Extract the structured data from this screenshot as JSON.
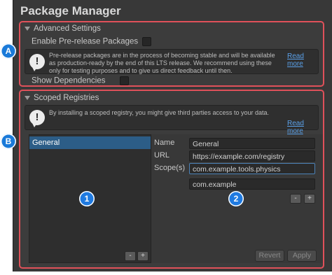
{
  "window": {
    "title": "Package Manager"
  },
  "advanced": {
    "header": "Advanced Settings",
    "prerelease_label": "Enable Pre-release Packages",
    "prerelease_checked": false,
    "help_text": "Pre-release packages are in the process of becoming stable and will be available as production-ready by the end of this LTS release. We recommend using these only for testing purposes and to give us direct feedback until then.",
    "read_more": "Read more",
    "show_deps_label": "Show Dependencies",
    "show_deps_checked": false
  },
  "scoped": {
    "header": "Scoped Registries",
    "help_text": "By installing a scoped registry, you might give third parties access to your data.",
    "read_more": "Read more",
    "registries": [
      "General"
    ],
    "fields": {
      "name_label": "Name",
      "name_value": "General",
      "url_label": "URL",
      "url_value": "https://example.com/registry",
      "scope_label": "Scope(s)",
      "scopes": [
        "com.example.tools.physics",
        "com.example"
      ]
    },
    "list_minus": "-",
    "list_plus": "+",
    "scope_minus": "-",
    "scope_plus": "+",
    "revert_label": "Revert",
    "apply_label": "Apply"
  },
  "callouts": {
    "a": "A",
    "b": "B",
    "one": "1",
    "two": "2"
  },
  "colors": {
    "highlight_border": "#e0515a",
    "badge": "#1f7ae0",
    "selection": "#2c5d87",
    "link": "#5aa0e8"
  },
  "icons": [
    "foldout-arrow-icon",
    "help-info-icon"
  ]
}
